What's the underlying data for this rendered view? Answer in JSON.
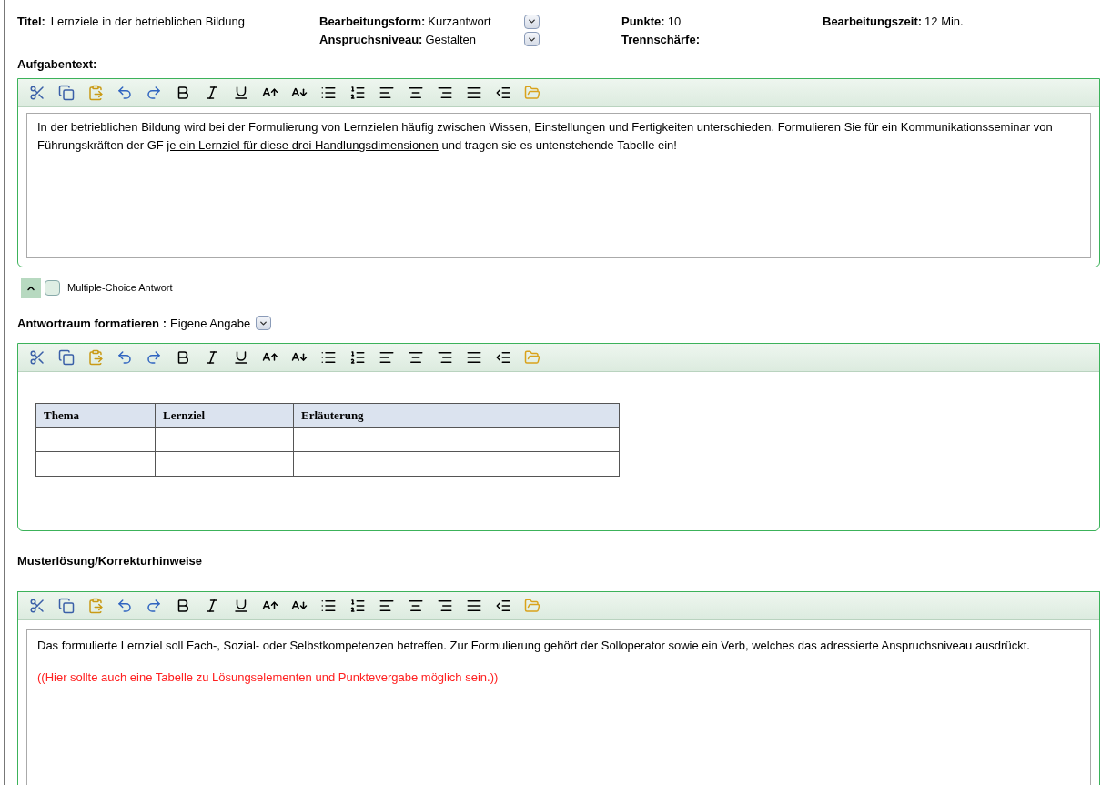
{
  "header": {
    "title": {
      "label": "Titel:",
      "value": "Lernziele in der betrieblichen Bildung"
    },
    "bearbeitungsform": {
      "label": "Bearbeitungsform:",
      "value": "Kurzantwort"
    },
    "anspruchsniveau": {
      "label": "Anspruchsniveau:",
      "value": "Gestalten"
    },
    "punkte": {
      "label": "Punkte:",
      "value": "10"
    },
    "trennschaerfe": {
      "label": "Trennschärfe:"
    },
    "bearbeitungszeit": {
      "label": "Bearbeitungszeit:",
      "value": "12 Min."
    }
  },
  "aufgabentext": {
    "label": "Aufgabentext:",
    "segments": [
      {
        "text": "In der betrieblichen Bildung wird bei der Formulierung von Lernzielen häufig zwischen Wissen, Einstellungen und Fertigkeiten unterschieden. Formulieren Sie für ein Kommunikationsseminar von Führungskräften der GF ",
        "underlined": false
      },
      {
        "text": "je ein Lernziel für diese drei Handlungsdimensionen",
        "underlined": true
      },
      {
        "text": " und tragen sie es untenstehende Tabelle ein!",
        "underlined": false
      }
    ]
  },
  "multiple_choice": {
    "label": "Multiple-Choice Antwort",
    "checked": false
  },
  "antwortraum": {
    "label": "Antwortraum formatieren :",
    "value": "Eigene Angabe",
    "table": {
      "columns": [
        "Thema",
        "Lernziel",
        "Erläuterung"
      ],
      "rows": [
        {
          "kind": "empty"
        },
        {
          "kind": "empty"
        }
      ]
    }
  },
  "musterloesung": {
    "label": "Musterlösung/Korrekturhinweise",
    "paragraphs": [
      {
        "kind": "normal",
        "text": "Das formulierte Lernziel  soll Fach-, Sozial- oder Selbstkompetenzen betreffen. Zur Formulierung gehört der Solloperator sowie ein Verb, welches das adressierte Anspruchsniveau ausdrückt."
      },
      {
        "kind": "remark",
        "text": "((Hier sollte auch eine Tabelle zu Lösungselementen und Punktevergabe möglich sein.))"
      }
    ]
  }
}
